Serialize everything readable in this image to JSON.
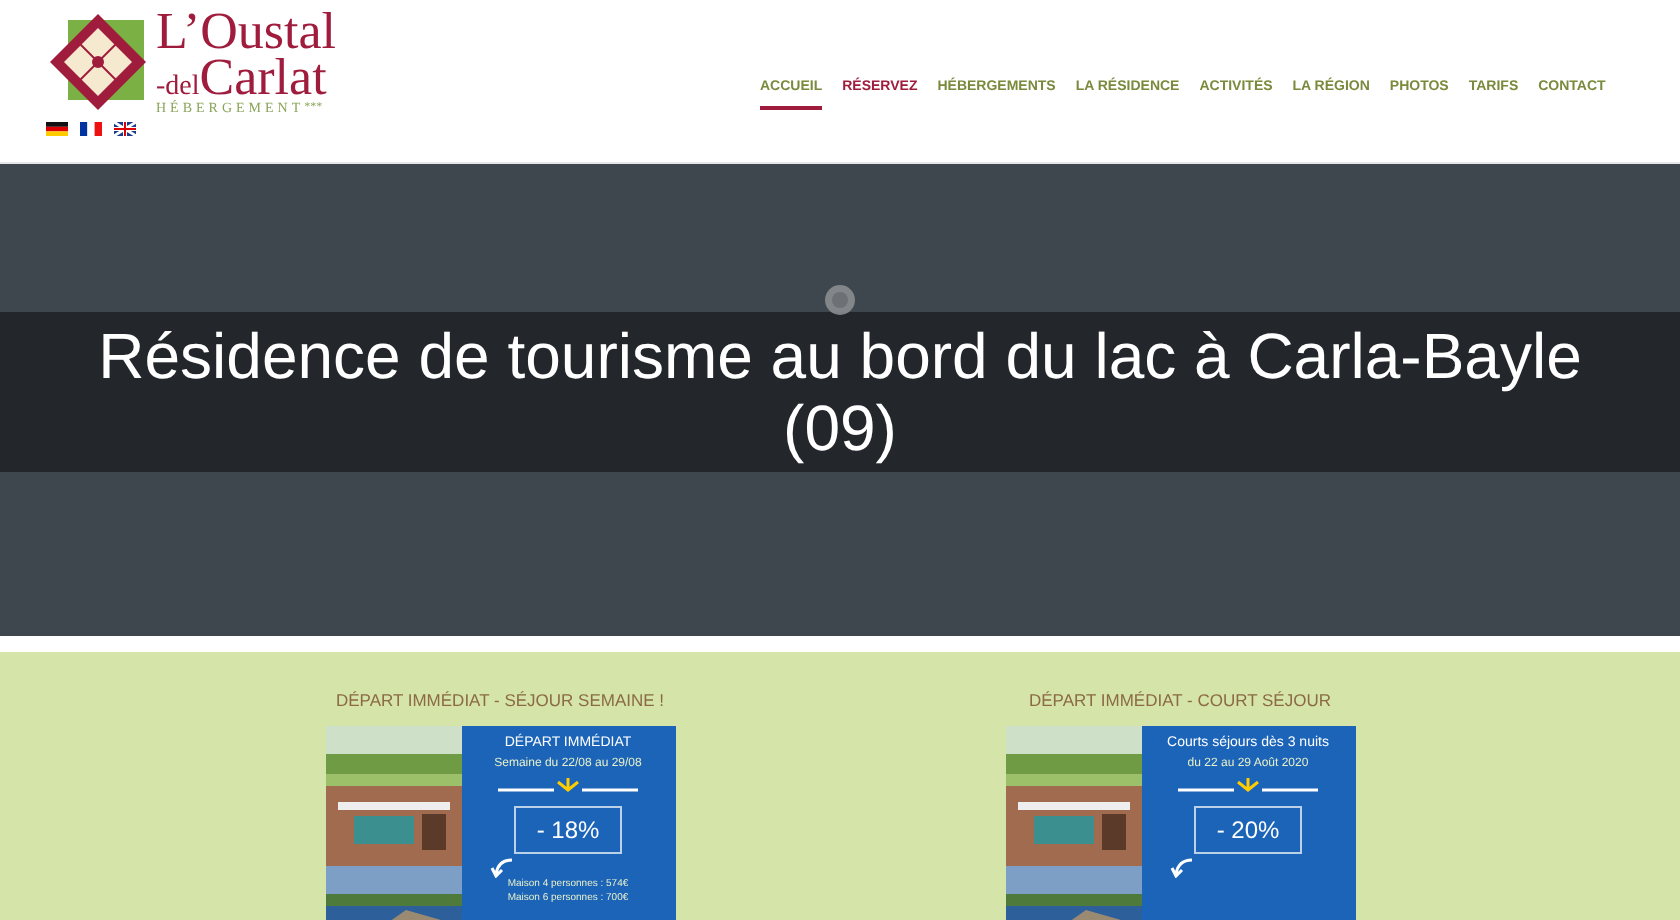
{
  "logo": {
    "line_1": "L’Oustal",
    "line_2a": "-del",
    "line_2b": "Carlat",
    "tagline": "HÉBERGEMENT",
    "stars": "***"
  },
  "languages": [
    {
      "kind": "de"
    },
    {
      "kind": "fr"
    },
    {
      "kind": "gb"
    }
  ],
  "nav": [
    {
      "label": "ACCUEIL",
      "selected": true,
      "emphasis": false
    },
    {
      "label": "RÉSERVEZ",
      "selected": false,
      "emphasis": true
    },
    {
      "label": "HÉBERGEMENTS",
      "selected": false,
      "emphasis": false
    },
    {
      "label": "LA RÉSIDENCE",
      "selected": false,
      "emphasis": false
    },
    {
      "label": "ACTIVITÉS",
      "selected": false,
      "emphasis": false
    },
    {
      "label": "LA RÉGION",
      "selected": false,
      "emphasis": false
    },
    {
      "label": "PHOTOS",
      "selected": false,
      "emphasis": false
    },
    {
      "label": "TARIFS",
      "selected": false,
      "emphasis": false
    },
    {
      "label": "CONTACT",
      "selected": false,
      "emphasis": false
    }
  ],
  "hero": {
    "title": "Résidence de tourisme au bord du lac à Carla-Bayle (09)"
  },
  "offers": [
    {
      "title": "DÉPART IMMÉDIAT - SÉJOUR SEMAINE !",
      "heading": "DÉPART IMMÉDIAT",
      "subheading": "Semaine du 22/08 au 29/08",
      "discount": "- 18%",
      "prices": [
        "Maison 4 personnes : 574€",
        "Maison 6 personnes : 700€"
      ]
    },
    {
      "title": "DÉPART IMMÉDIAT - COURT SÉJOUR",
      "heading": "Courts séjours dès 3 nuits",
      "subheading": "du 22 au 29 Août 2020",
      "discount": "- 20%"
    }
  ]
}
